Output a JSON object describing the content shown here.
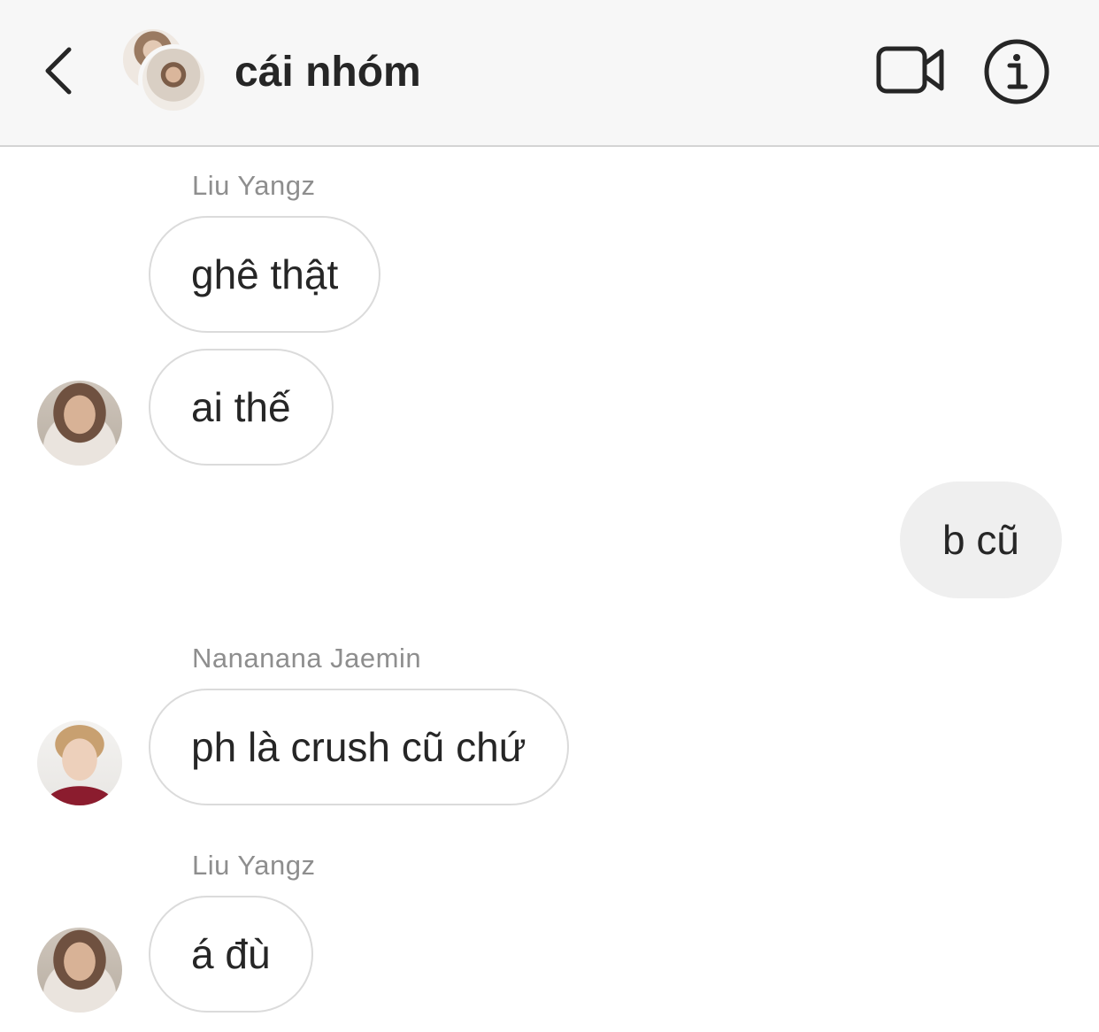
{
  "header": {
    "title": "cái nhóm",
    "icons": {
      "back": "chevron-left-icon",
      "video": "video-camera-icon",
      "info": "info-icon"
    }
  },
  "messages": [
    {
      "sender": "Liu Yangz",
      "text": "ghê thật"
    },
    {
      "text": "ai thế"
    },
    {
      "text": "b cũ",
      "mine": true
    },
    {
      "sender": "Nananana Jaemin",
      "text": "ph là crush cũ chứ"
    },
    {
      "sender": "Liu Yangz",
      "text": "á đù"
    }
  ],
  "colors": {
    "header_bg": "#f7f7f7",
    "bubble_border": "#dbdbdb",
    "mine_bubble_bg": "#efefef",
    "sender_text": "#8e8e8e",
    "text": "#262626"
  }
}
